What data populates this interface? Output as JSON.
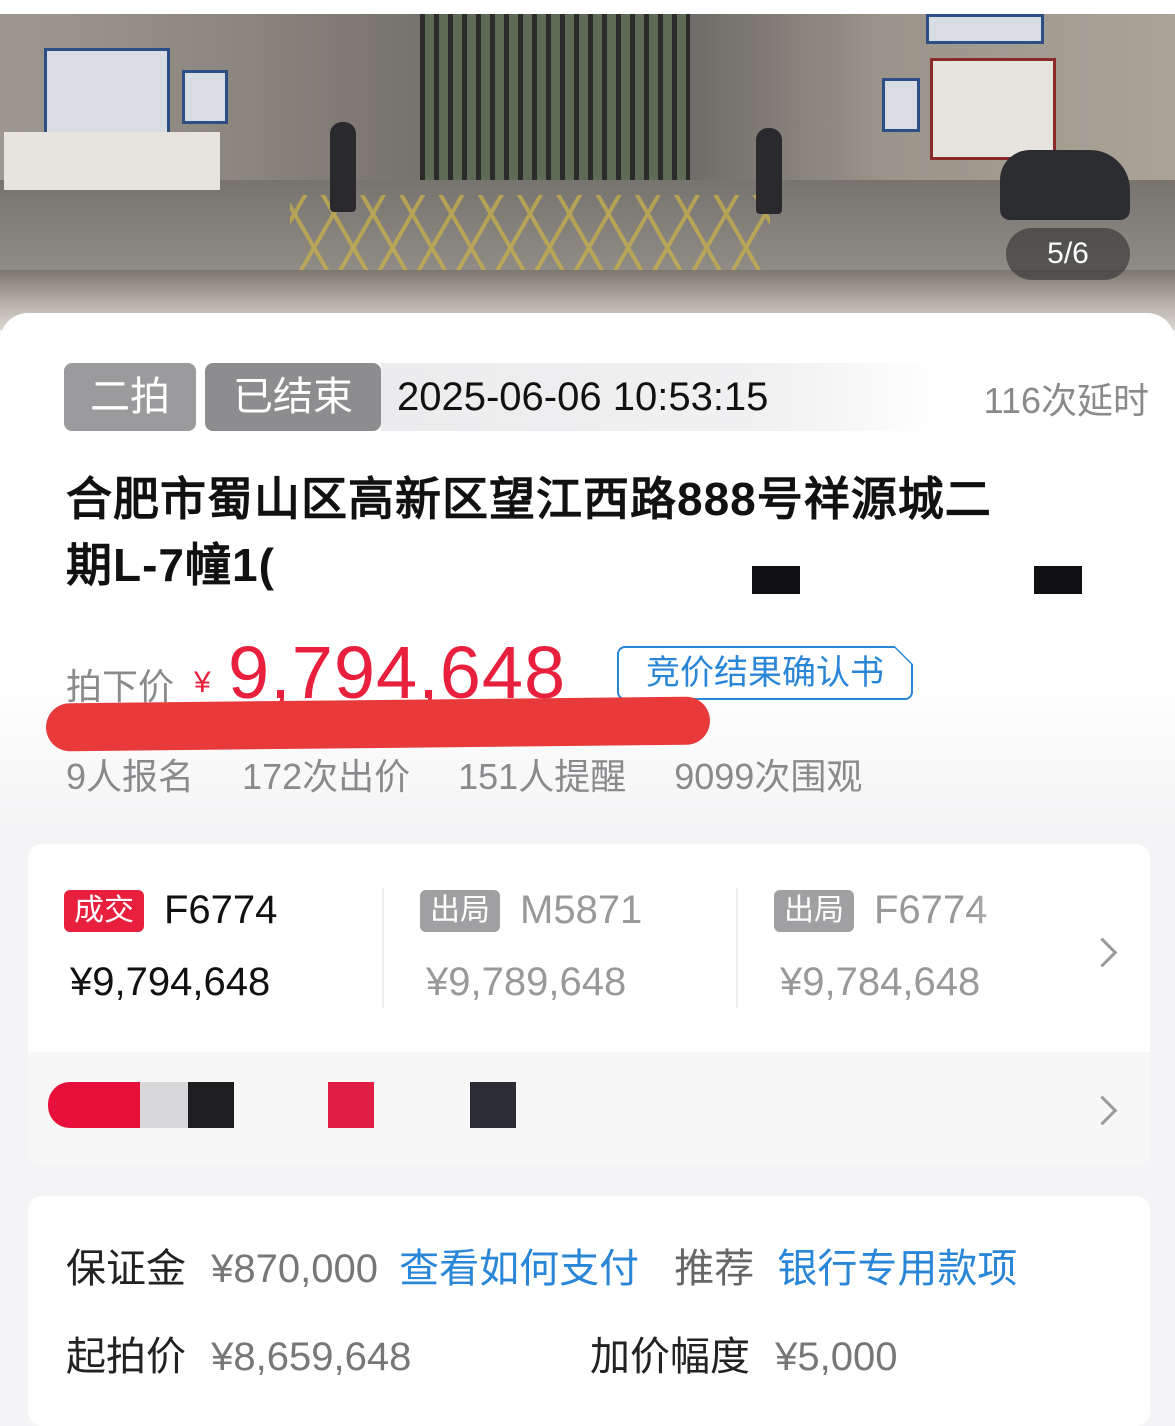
{
  "gallery": {
    "counter": "5/6"
  },
  "auction": {
    "round_tag": "二拍",
    "status_tag": "已结束",
    "end_time": "2025-06-06 10:53:15",
    "extensions": "116次延时",
    "title_line1": "合肥市蜀山区高新区望江西路888号祥源城二",
    "title_line2": "期L-7幢1(",
    "price_label": "拍下价",
    "currency": "¥",
    "price": "9,794,648",
    "confirm_label": "竞价结果确认书",
    "stats": {
      "registered": "9人报名",
      "bids": "172次出价",
      "reminders": "151人提醒",
      "views": "9099次围观"
    }
  },
  "bids": [
    {
      "badge": "成交",
      "code": "F6774",
      "price": "¥9,794,648",
      "badge_color": "#e8203d"
    },
    {
      "badge": "出局",
      "code": "M5871",
      "price": "¥9,789,648",
      "badge_color": "#a0a0a2"
    },
    {
      "badge": "出局",
      "code": "F6774",
      "price": "¥9,784,648",
      "badge_color": "#a0a0a2"
    }
  ],
  "deposit": {
    "label": "保证金",
    "value": "¥870,000",
    "how_to_pay": "查看如何支付",
    "recommend_label": "推荐",
    "recommend_link": "银行专用款项"
  },
  "starting": {
    "label": "起拍价",
    "value": "¥8,659,648"
  },
  "increment": {
    "label": "加价幅度",
    "value": "¥5,000"
  },
  "colors": {
    "accent_red": "#e8203d",
    "link_blue": "#2a86d6",
    "muted_gray": "#8a8a8c"
  }
}
